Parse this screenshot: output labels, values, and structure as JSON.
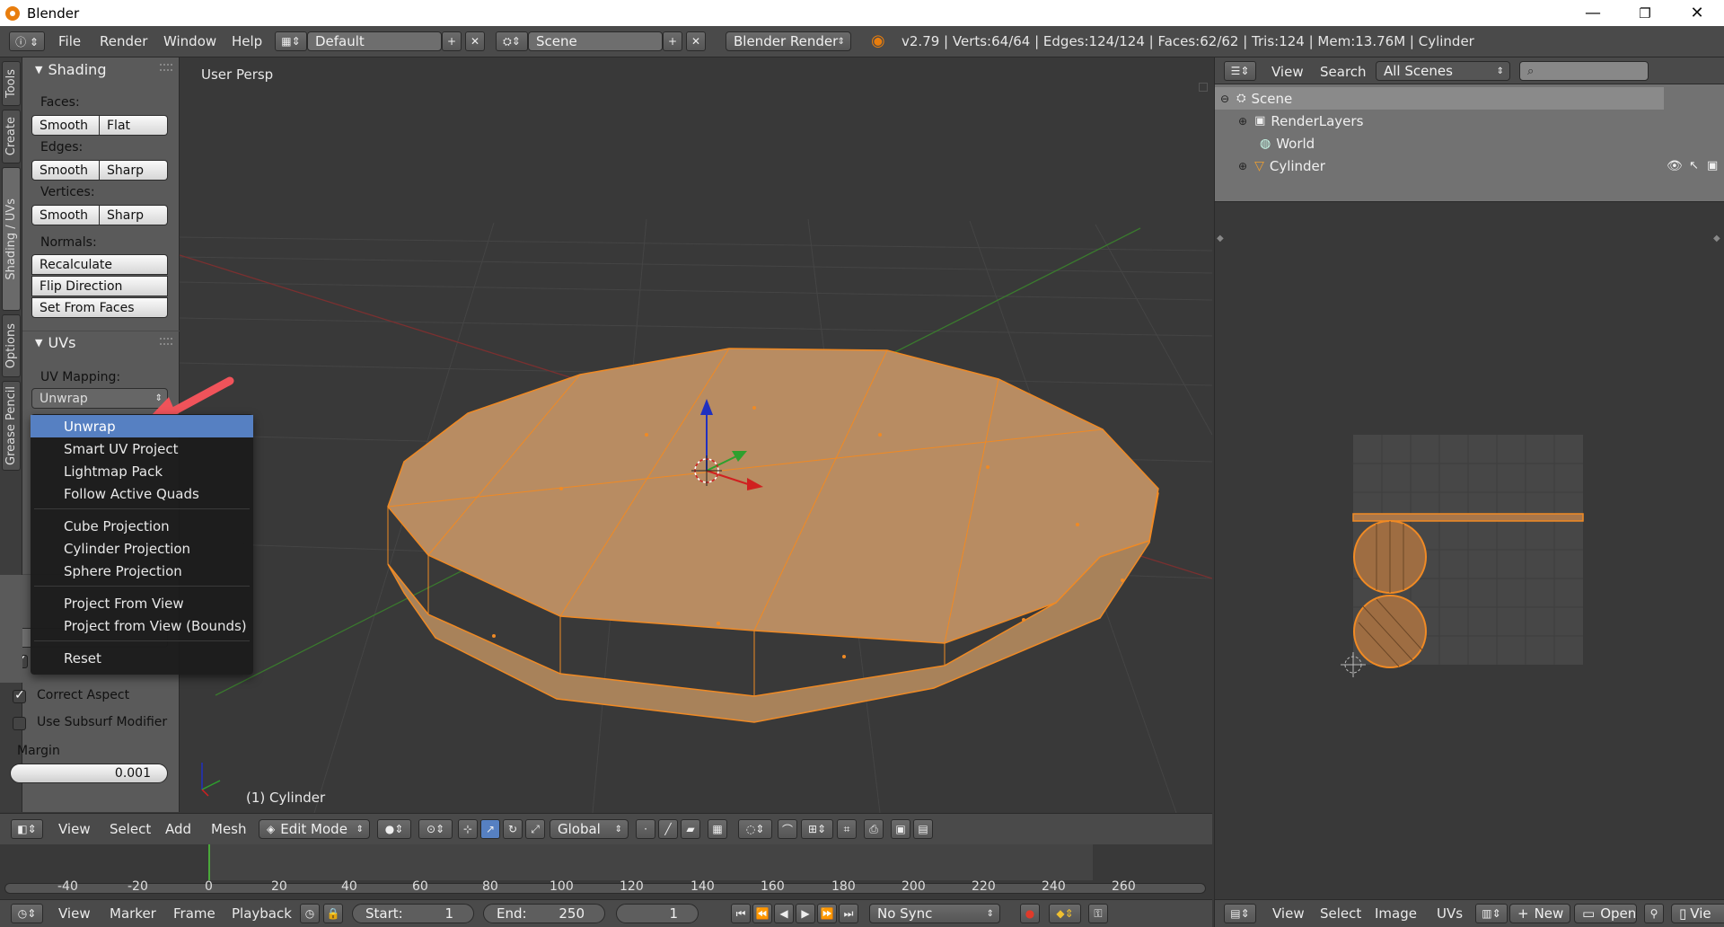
{
  "window": {
    "title": "Blender",
    "controls": {
      "minimize": "—",
      "maximize": "❐",
      "close": "✕"
    }
  },
  "info_header": {
    "menus": [
      "File",
      "Render",
      "Window",
      "Help"
    ],
    "screen_layout": "Default",
    "scene": "Scene",
    "render_engine": "Blender Render",
    "stats": "v2.79 | Verts:64/64 | Edges:124/124 | Faces:62/62 | Tris:124 | Mem:13.76M | Cylinder"
  },
  "tool_tabs": [
    "Tools",
    "Create",
    "Shading / UVs",
    "Options",
    "Grease Pencil"
  ],
  "shading_panel": {
    "title": "Shading",
    "faces_label": "Faces:",
    "faces_buttons": [
      "Smooth",
      "Flat"
    ],
    "edges_label": "Edges:",
    "edges_buttons": [
      "Smooth",
      "Sharp"
    ],
    "vertices_label": "Vertices:",
    "vertices_buttons": [
      "Smooth",
      "Sharp"
    ],
    "normals_label": "Normals:",
    "normals_buttons": [
      "Recalculate",
      "Flip Direction",
      "Set From Faces"
    ]
  },
  "uvs_panel": {
    "title": "UVs",
    "uv_mapping_label": "UV Mapping:",
    "uv_mapping_value": "Unwrap"
  },
  "unwrap_panel": {
    "correct_aspect": {
      "label": "Correct Aspect",
      "checked": true
    },
    "use_subsurf": {
      "label": "Use Subsurf Modifier",
      "checked": false
    },
    "margin_label": "Margin",
    "margin_value": "0.001"
  },
  "uv_menu": {
    "groups": [
      [
        "Unwrap",
        "Smart UV Project",
        "Lightmap Pack",
        "Follow Active Quads"
      ],
      [
        "Cube Projection",
        "Cylinder Projection",
        "Sphere Projection"
      ],
      [
        "Project From View",
        "Project from View (Bounds)"
      ],
      [
        "Reset"
      ]
    ],
    "selected": "Unwrap"
  },
  "viewport": {
    "view_label": "User Persp",
    "object_label": "(1) Cylinder"
  },
  "viewport_header": {
    "menus": [
      "View",
      "Select",
      "Add",
      "Mesh"
    ],
    "mode": "Edit Mode",
    "orientation": "Global"
  },
  "outliner": {
    "menus": [
      "View",
      "Search"
    ],
    "display_mode": "All Scenes",
    "rows": [
      "Scene",
      "RenderLayers",
      "World",
      "Cylinder"
    ]
  },
  "timeline": {
    "ticks": [
      "-40",
      "-20",
      "0",
      "20",
      "40",
      "60",
      "80",
      "100",
      "120",
      "140",
      "160",
      "180",
      "200",
      "220",
      "240",
      "260"
    ],
    "menus": [
      "View",
      "Marker",
      "Frame",
      "Playback"
    ],
    "start_label": "Start:",
    "start_value": "1",
    "end_label": "End:",
    "end_value": "250",
    "current_frame": "1",
    "sync": "No Sync"
  },
  "uv_header": {
    "menus": [
      "View",
      "Select",
      "Image",
      "UVs"
    ],
    "new_label": "New",
    "open_label": "Open",
    "last_label": "Vie"
  },
  "colors": {
    "accent": "#5680c2",
    "selection_orange": "#f08a24",
    "mesh_fill": "#b88c62",
    "annotation_arrow": "#f0535a"
  }
}
